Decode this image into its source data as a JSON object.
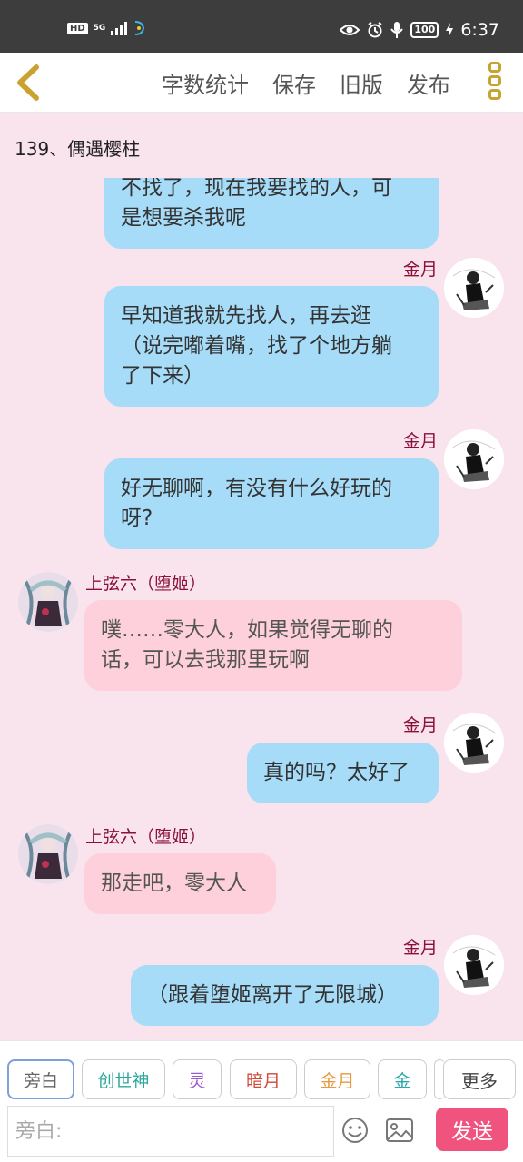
{
  "status_bar": {
    "network_hd": "HD",
    "network_5g": "5G",
    "battery": "100",
    "time": "6:37"
  },
  "header": {
    "actions": [
      "字数统计",
      "保存",
      "旧版",
      "发布"
    ],
    "icons": {
      "back": "chevron-left-icon",
      "more": "more-vertical-icon"
    },
    "accent": "#c9a230"
  },
  "chapter": {
    "title": "139、偶遇樱柱"
  },
  "messages": [
    {
      "side": "right",
      "name": "",
      "lines": [
        "不找了，现在我要找的人，可",
        "是想要杀我呢"
      ]
    },
    {
      "side": "right",
      "name": "金月",
      "lines": [
        "早知道我就先找人，再去逛",
        "（说完嘟着嘴，找了个地方躺",
        "了下来）"
      ]
    },
    {
      "side": "right",
      "name": "金月",
      "lines": [
        "好无聊啊，有没有什么好玩的",
        "呀?"
      ]
    },
    {
      "side": "left",
      "name": "上弦六（堕姬）",
      "lines": [
        "噗……零大人，如果觉得无聊的",
        "话，可以去我那里玩啊"
      ]
    },
    {
      "side": "right",
      "name": "金月",
      "lines": [
        "真的吗？太好了"
      ]
    },
    {
      "side": "left",
      "name": "上弦六（堕姬）",
      "lines": [
        "那走吧，零大人"
      ]
    },
    {
      "side": "right",
      "name": "金月",
      "lines": [
        "（跟着堕姬离开了无限城）"
      ]
    }
  ],
  "characters": [
    {
      "label": "旁白",
      "color": "#666666",
      "active": true
    },
    {
      "label": "创世神",
      "color": "#2aa89a",
      "active": false
    },
    {
      "label": "灵",
      "color": "#a05ad0",
      "active": false
    },
    {
      "label": "暗月",
      "color": "#d04a3a",
      "active": false
    },
    {
      "label": "金月",
      "color": "#e89a40",
      "active": false
    },
    {
      "label": "金",
      "color": "#2aa8a8",
      "active": false
    }
  ],
  "more_label": "更多",
  "input": {
    "placeholder": "旁白:",
    "send_label": "发送"
  },
  "colors": {
    "bubble_blue": "#a6dcf8",
    "bubble_pink": "#fdd0dc",
    "background": "#f9e3ec",
    "send": "#f0537d",
    "name": "#8a1038"
  }
}
